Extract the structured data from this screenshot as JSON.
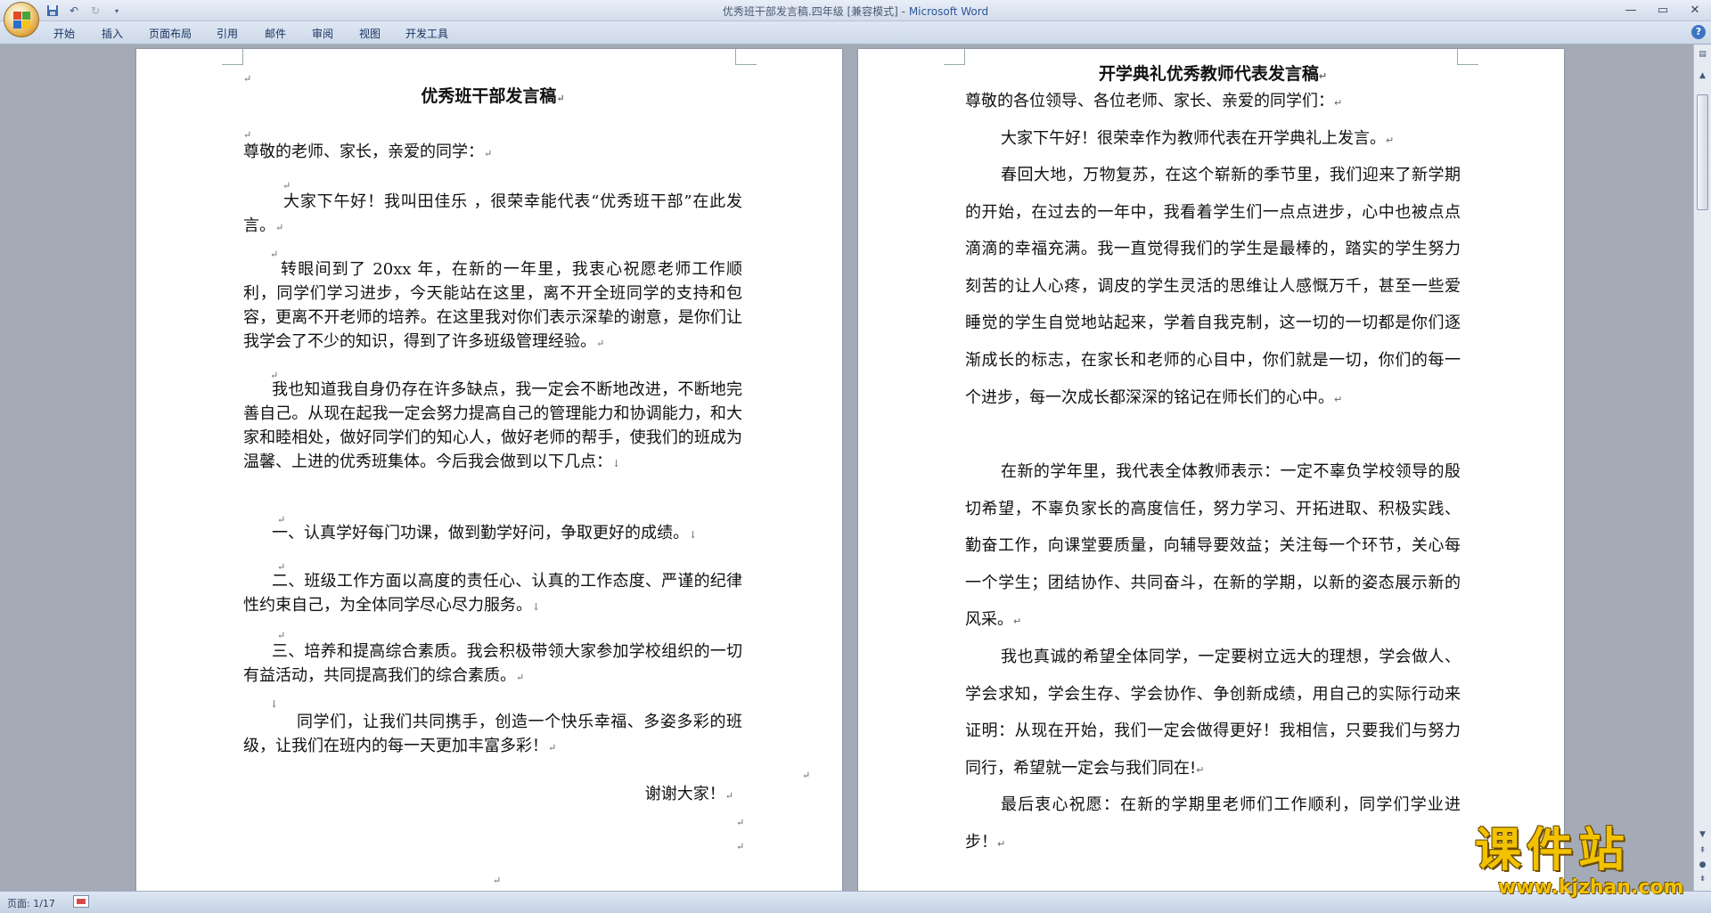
{
  "window": {
    "title_doc": "优秀班干部发言稿.四年级 [兼容模式] - ",
    "title_app": "Microsoft Word",
    "min_icon": "minimize-icon",
    "max_icon": "maximize-icon",
    "close_icon": "close-icon"
  },
  "ribbon": {
    "tabs": [
      "开始",
      "插入",
      "页面布局",
      "引用",
      "邮件",
      "审阅",
      "视图",
      "开发工具"
    ]
  },
  "page1": {
    "title": "优秀班干部发言稿",
    "greeting": "尊敬的老师、家长，亲爱的同学：",
    "paragraphs": [
      "大家下午好！我叫田佳乐 ，很荣幸能代表“优秀班干部”在此发言。",
      "转眼间到了 20xx 年，在新的一年里，我衷心祝愿老师工作顺利，同学们学习进步，今天能站在这里，离不开全班同学的支持和包容，更离不开老师的培养。在这里我对你们表示深挚的谢意，是你们让我学会了不少的知识，得到了许多班级管理经验。",
      "我也知道我自身仍存在许多缺点，我一定会不断地改进，不断地完善自己。从现在起我一定会努力提高自己的管理能力和协调能力，和大家和睦相处，做好同学们的知心人，做好老师的帮手，使我们的班成为温馨、上进的优秀班集体。今后我会做到以下几点：",
      "一、认真学好每门功课，做到勤学好问，争取更好的成绩。",
      "二、班级工作方面以高度的责任心、认真的工作态度、严谨的纪律性约束自己，为全体同学尽心尽力服务。",
      "三、培养和提高综合素质。我会积极带领大家参加学校组织的一切有益活动，共同提高我们的综合素质。",
      "同学们，让我们共同携手，创造一个快乐幸福、多姿多彩的班级，让我们在班内的每一天更加丰富多彩！"
    ],
    "closing": "谢谢大家！"
  },
  "page2": {
    "title": "开学典礼优秀教师代表发言稿",
    "greeting": "尊敬的各位领导、各位老师、家长、亲爱的同学们：",
    "paragraphs": [
      "大家下午好！很荣幸作为教师代表在开学典礼上发言。",
      "春回大地，万物复苏，在这个崭新的季节里，我们迎来了新学期的开始，在过去的一年中，我看着学生们一点点进步，心中也被点点滴滴的幸福充满。我一直觉得我们的学生是最棒的，踏实的学生努力刻苦的让人心疼，调皮的学生灵活的思维让人感慨万千，甚至一些爱睡觉的学生自觉地站起来，学着自我克制，这一切的一切都是你们逐渐成长的标志，在家长和老师的心目中，你们就是一切，你们的每一个进步，每一次成长都深深的铭记在师长们的心中。",
      "在新的学年里，我代表全体教师表示：一定不辜负学校领导的殷切希望，不辜负家长的高度信任，努力学习、开拓进取、积极实践、勤奋工作，向课堂要质量，向辅导要效益；关注每一个环节，关心每一个学生；团结协作、共同奋斗，在新的学期，以新的姿态展示新的风采。",
      "我也真诚的希望全体同学，一定要树立远大的理想，学会做人、学会求知，学会生存、学会协作、争创新成绩，用自己的实际行动来证明：从现在开始，我们一定会做得更好！我相信，只要我们与努力同行，希望就一定会与我们同在!",
      "最后衷心祝愿：在新的学期里老师们工作顺利，同学们学业进步！"
    ]
  },
  "status": {
    "page": "页面: 1/17"
  },
  "watermark": {
    "brand": "课件站",
    "url": "www.kjzhan.com"
  },
  "colors": {
    "title_app": "#2b579a",
    "watermark": "#f2c200",
    "workspace": "#a4abb7"
  }
}
